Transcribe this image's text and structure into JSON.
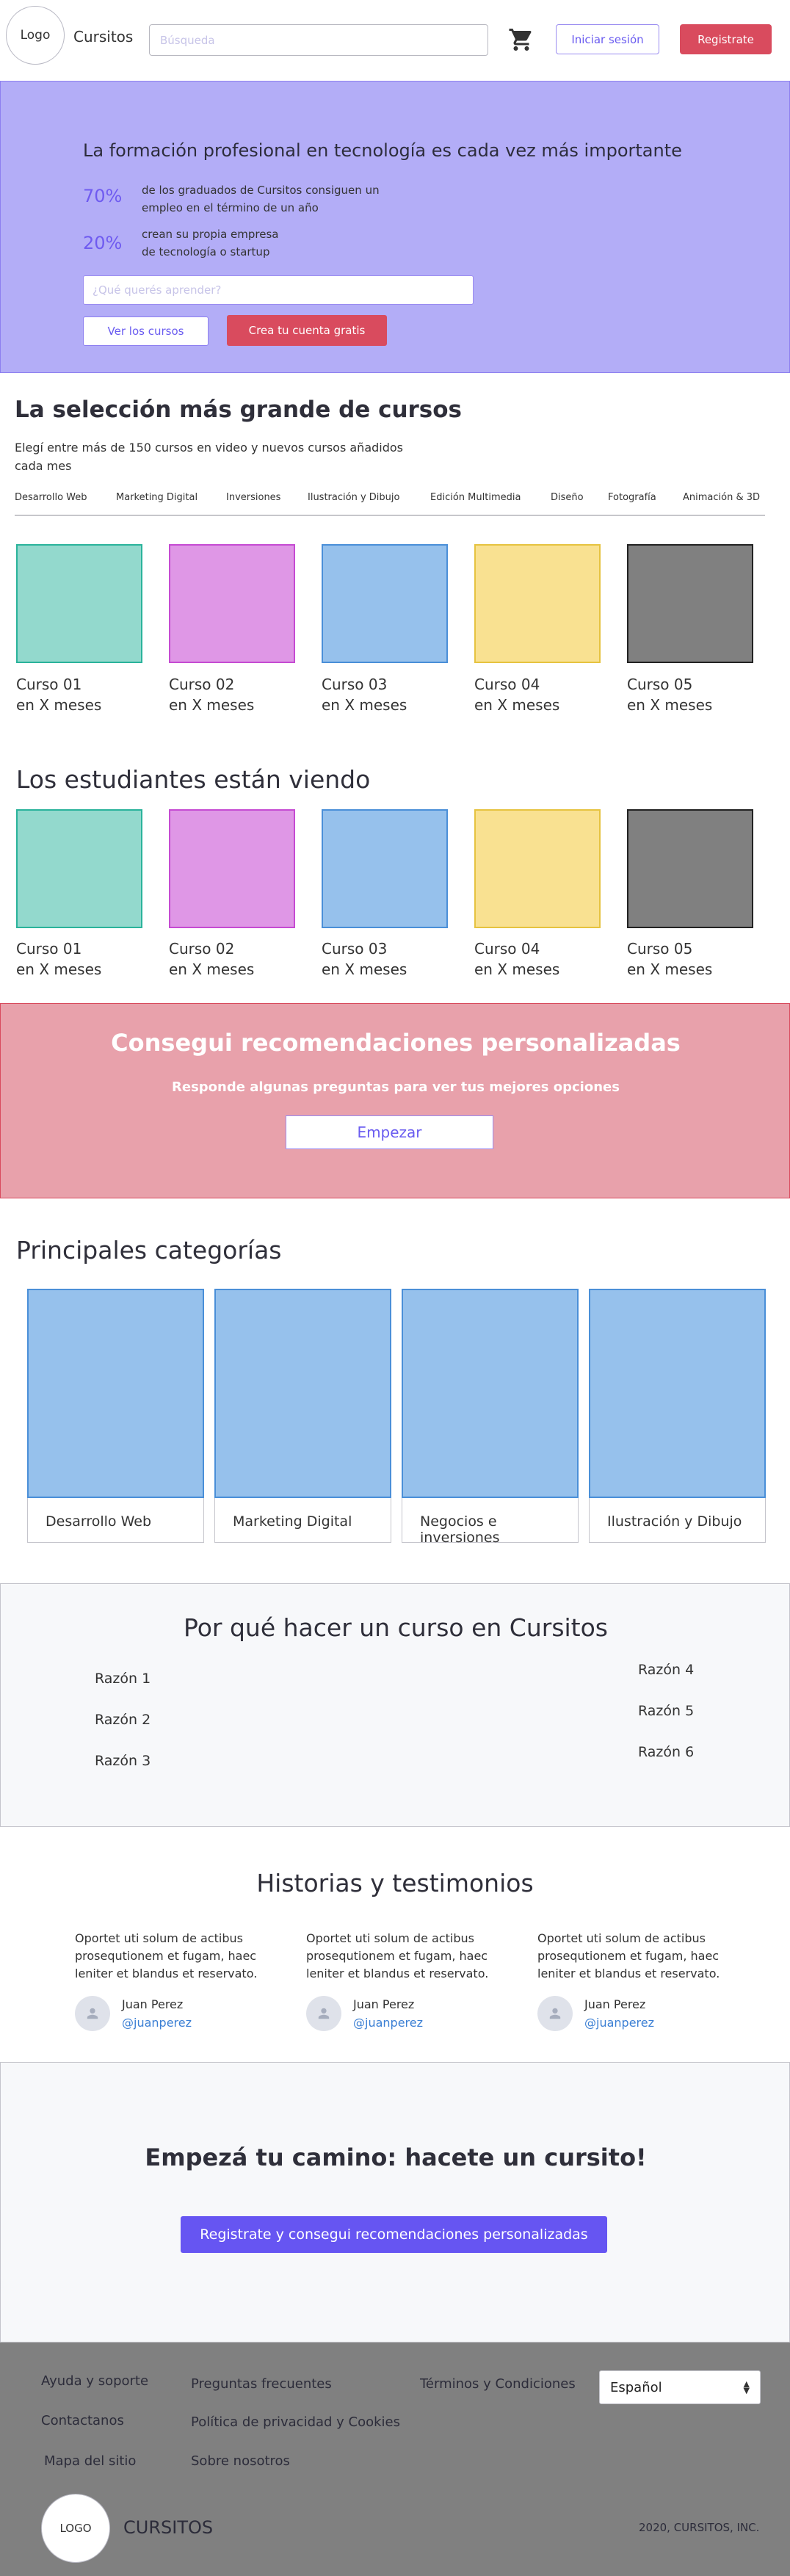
{
  "header": {
    "logo": "Logo",
    "brand": "Cursitos",
    "search_placeholder": "Búsqueda",
    "login": "Iniciar sesión",
    "register": "Registrate"
  },
  "hero": {
    "title": "La formación profesional en tecnología es cada vez más importante",
    "stats": [
      {
        "value": "70%",
        "line1": "de los graduados de Cursitos consiguen un",
        "line2": "empleo en el término de un año"
      },
      {
        "value": "20%",
        "line1": "crean su propia empresa",
        "line2": "de tecnología o startup"
      }
    ],
    "input_placeholder": "¿Qué querés aprender?",
    "btn_courses": "Ver los cursos",
    "btn_free": "Crea tu cuenta gratis"
  },
  "selection": {
    "title": "La selección más grande de cursos",
    "subtitle_line1": "Elegí entre más de 150 cursos en video y nuevos cursos añadidos",
    "subtitle_line2": "cada mes",
    "tabs": [
      "Desarrollo Web",
      "Marketing Digital",
      "Inversiones",
      "Ilustración y Dibujo",
      "Edición Multimedia",
      "Diseño",
      "Fotografía",
      "Animación & 3D"
    ]
  },
  "courses": [
    {
      "name": "Curso 01",
      "duration": "en X meses",
      "fill": "#93d9cd",
      "border": "#2ab39b"
    },
    {
      "name": "Curso 02",
      "duration": "en X meses",
      "fill": "#df97e6",
      "border": "#c54bd2"
    },
    {
      "name": "Curso 03",
      "duration": "en X meses",
      "fill": "#96c1ec",
      "border": "#4a8fd8"
    },
    {
      "name": "Curso 04",
      "duration": "en X meses",
      "fill": "#f9e191",
      "border": "#e6c340"
    },
    {
      "name": "Curso 05",
      "duration": "en X meses",
      "fill": "#808080",
      "border": "#222222"
    }
  ],
  "watching": {
    "title": "Los estudiantes están viendo"
  },
  "recommend": {
    "title": "Consegui recomendaciones personalizadas",
    "subtitle": "Responde algunas preguntas para ver tus mejores opciones",
    "button": "Empezar"
  },
  "categories": {
    "title": "Principales categorías",
    "items": [
      "Desarrollo Web",
      "Marketing Digital",
      "Negocios e inversiones",
      "Ilustración y Dibujo"
    ]
  },
  "why": {
    "title": "Por qué hacer un curso en Cursitos",
    "reasons": [
      "Razón 1",
      "Razón 2",
      "Razón 3",
      "Razón 4",
      "Razón 5",
      "Razón 6"
    ]
  },
  "testimonials": {
    "title": "Historias y testimonios",
    "items": [
      {
        "line1": "Oportet uti solum de actibus",
        "line2": "prosequtionem et fugam, haec",
        "line3": "leniter et blandus et reservato.",
        "name": "Juan Perez",
        "handle": "@juanperez"
      },
      {
        "line1": "Oportet uti solum de actibus",
        "line2": "prosequtionem et fugam, haec",
        "line3": "leniter et blandus et reservato.",
        "name": "Juan Perez",
        "handle": "@juanperez"
      },
      {
        "line1": "Oportet uti solum de actibus",
        "line2": "prosequtionem et fugam, haec",
        "line3": "leniter et blandus et reservato.",
        "name": "Juan Perez",
        "handle": "@juanperez"
      }
    ]
  },
  "cta": {
    "title": "Empezá tu camino: hacete un cursito!",
    "button": "Registrate y consegui recomendaciones personalizadas"
  },
  "footer": {
    "links": [
      "Ayuda y soporte",
      "Contactanos",
      "Mapa del sitio",
      "Preguntas frecuentes",
      "Política de privacidad y Cookies",
      "Sobre nosotros",
      "Términos y Condiciones"
    ],
    "language": "Español",
    "logo": "LOGO",
    "brand": "CURSITOS",
    "copyright": "2020, CURSITOS, INC."
  },
  "icons": {
    "cart": "cart-icon",
    "avatar": "user-icon",
    "select": "select-arrows-icon"
  }
}
